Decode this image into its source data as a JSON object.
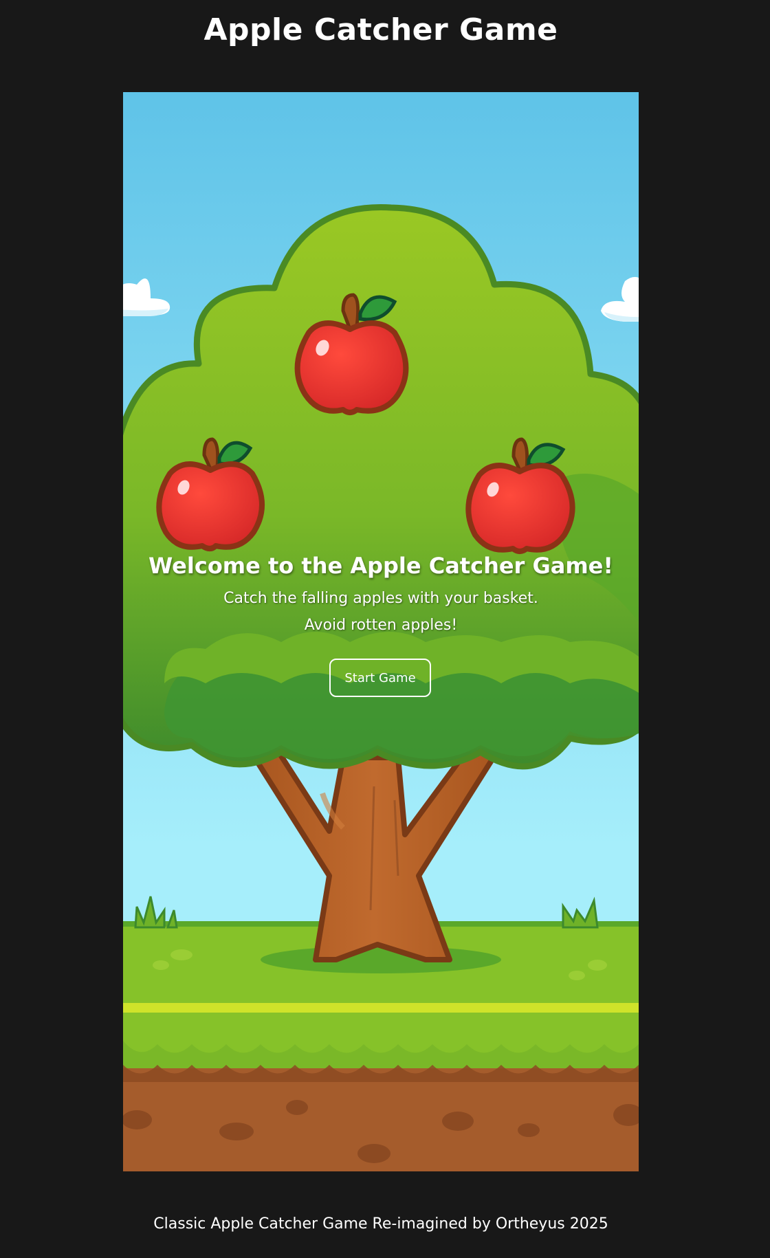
{
  "header": {
    "title": "Apple Catcher Game"
  },
  "game": {
    "welcome_title": "Welcome to the Apple Catcher Game!",
    "instructions": [
      "Catch the falling apples with your basket.",
      "Avoid rotten apples!"
    ],
    "start_button_label": "Start Game",
    "scene_elements": [
      "sky",
      "clouds",
      "apple-tree",
      "red-apple",
      "red-apple",
      "red-apple",
      "grass",
      "soil"
    ]
  },
  "footer": {
    "text": "Classic Apple Catcher Game Re-imagined by Ortheyus 2025"
  },
  "colors": {
    "page_background": "#181818",
    "sky_top": "#5fc3e8",
    "sky_bottom": "#a6eefb",
    "foliage": "#8ec428",
    "foliage_dark": "#3d8a2c",
    "trunk": "#b5622a",
    "apple": "#e8322e",
    "grass": "#86c229",
    "soil": "#a55c2c"
  }
}
